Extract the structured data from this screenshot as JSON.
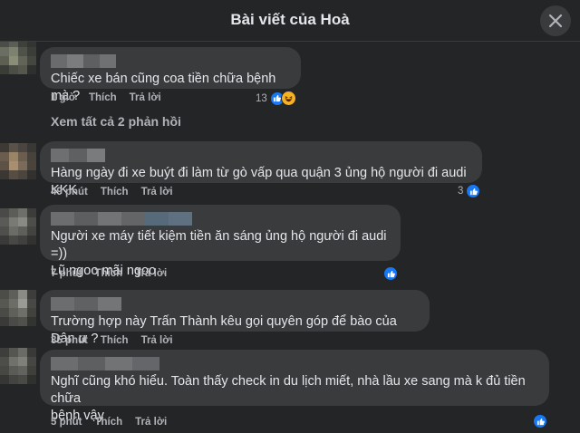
{
  "header": {
    "title": "Bài viết của Hoà"
  },
  "view_replies": "Xem tất cả 2 phản hồi",
  "comments": [
    {
      "text": "Chiếc xe bán cũng coa tiền chữa bệnh mà ?",
      "time": "1 giờ",
      "like": "Thích",
      "reply": "Trả lời",
      "reaction_count": "13",
      "reactions": [
        "like-icon",
        "haha-icon"
      ]
    },
    {
      "text": "Hàng ngày đi xe buýt đi làm từ gò vấp qua quận 3 ủng hộ người đi audi KKK",
      "time": "49 phút",
      "like": "Thích",
      "reply": "Trả lời",
      "reaction_count": "3",
      "reactions": [
        "like-icon"
      ]
    },
    {
      "text": "Người xe máy tiết kiệm tiền ăn sáng ủng hộ người đi audi =))",
      "text2": "Lũ ngoo mãi ngoo...",
      "time": "7 phút",
      "like": "Thích",
      "reply": "Trả lời",
      "reaction_count": "",
      "reactions": [
        "like-icon"
      ]
    },
    {
      "text": "Trường hợp này Trấn Thành kêu gọi quyên góp để bào của Dân ư ?",
      "time": "35 phút",
      "like": "Thích",
      "reply": "Trả lời",
      "reaction_count": "",
      "reactions": []
    },
    {
      "text": "Nghĩ cũng khó hiểu. Toàn thấy check in du lịch miết, nhà lầu xe sang mà k đủ tiền chữa",
      "text2": "bệnh vậy",
      "time": "5 phút",
      "like": "Thích",
      "reply": "Trả lời",
      "reaction_count": "",
      "reactions": [
        "like-icon"
      ]
    }
  ]
}
